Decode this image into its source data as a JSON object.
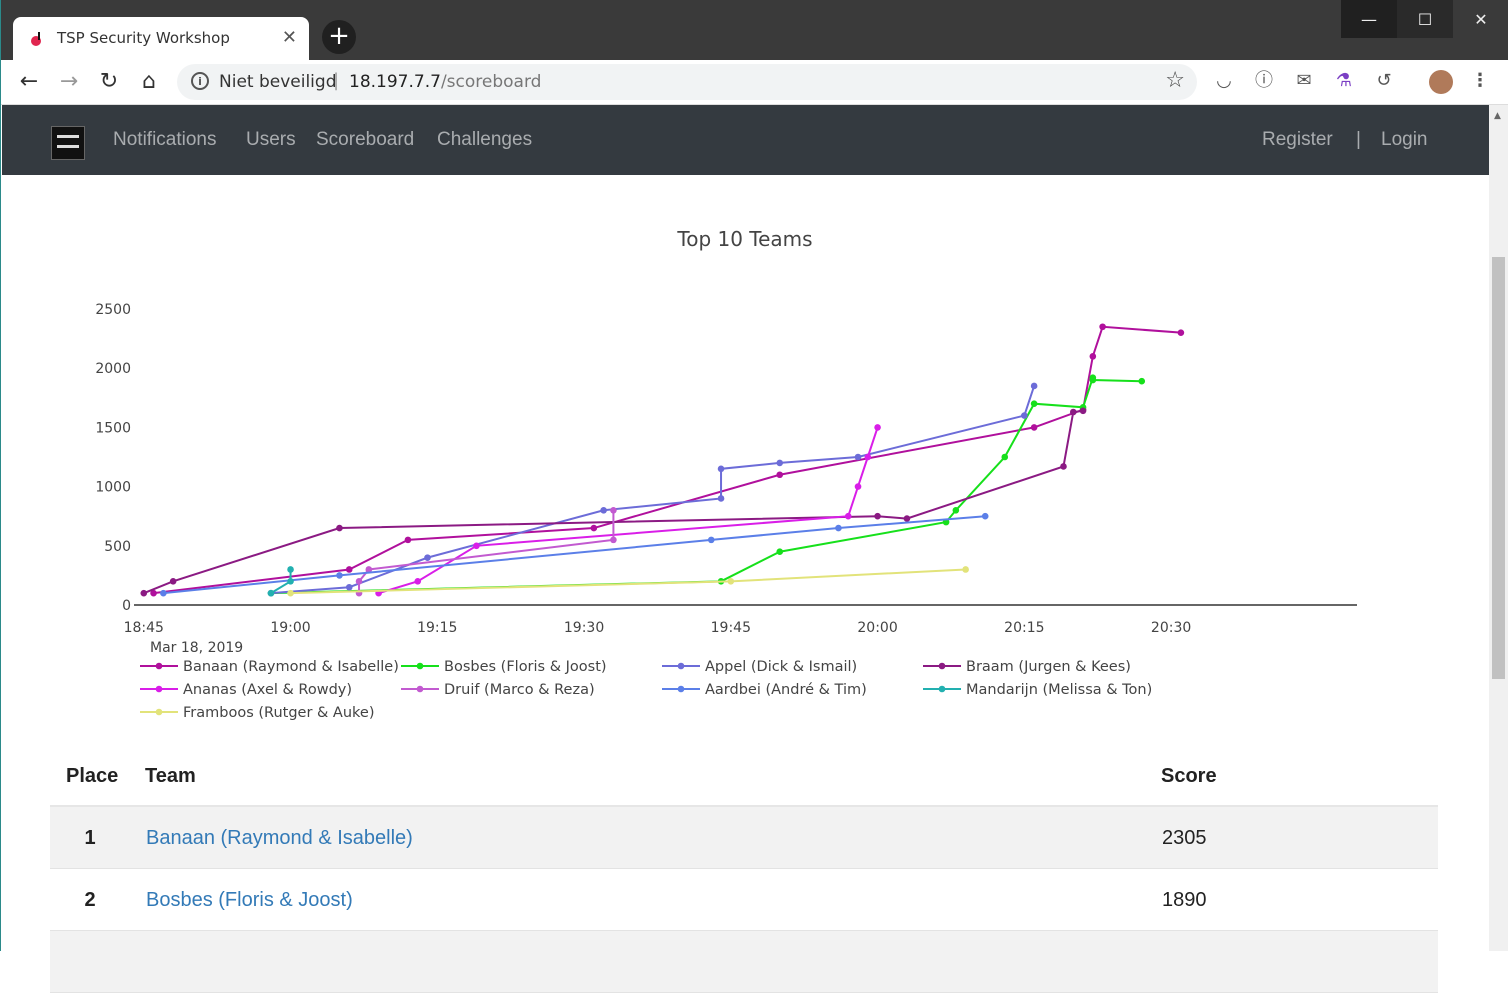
{
  "browser": {
    "tab_title": "TSP Security Workshop",
    "tab_close": "✕",
    "new_tab": "+",
    "window_min": "—",
    "window_max": "☐",
    "window_close": "✕",
    "security_label": "Niet beveiligd",
    "url_host": "18.197.7.7",
    "url_path": "/scoreboard",
    "icons": [
      "back-icon",
      "forward-icon",
      "reload-icon",
      "home-icon",
      "info-icon",
      "star-icon",
      "pocket-icon",
      "privacy-icon",
      "mail-icon",
      "flask-icon",
      "history-icon",
      "avatar",
      "menu-icon"
    ]
  },
  "navbar": {
    "links": [
      "Notifications",
      "Users",
      "Scoreboard",
      "Challenges"
    ],
    "register": "Register",
    "separator": "|",
    "login": "Login"
  },
  "chart_data": {
    "type": "line",
    "title": "Top 10 Teams",
    "xlabel": "",
    "ylabel": "",
    "x_ticks": [
      "18:45",
      "19:00",
      "19:15",
      "19:30",
      "19:45",
      "20:00",
      "20:15",
      "20:30"
    ],
    "x_date_label": "Mar 18, 2019",
    "y_ticks": [
      0,
      500,
      1000,
      1500,
      2000,
      2500
    ],
    "ylim": [
      0,
      2500
    ],
    "xlim": [
      "18:44",
      "20:49"
    ],
    "grid": false,
    "legend_position": "bottom",
    "series": [
      {
        "name": "Banaan (Raymond & Isabelle)",
        "color": "#b0109c",
        "x": [
          "18:46",
          "19:06",
          "19:12",
          "19:31",
          "19:50",
          "20:16",
          "20:21",
          "20:22",
          "20:23",
          "20:31"
        ],
        "y": [
          100,
          300,
          550,
          650,
          1100,
          1500,
          1650,
          2100,
          2350,
          2300
        ]
      },
      {
        "name": "Bosbes (Floris & Joost)",
        "color": "#16e01b",
        "x": [
          "18:58",
          "19:44",
          "19:50",
          "20:07",
          "20:08",
          "20:13",
          "20:16",
          "20:21",
          "20:22",
          "20:22",
          "20:27"
        ],
        "y": [
          100,
          200,
          450,
          700,
          800,
          1250,
          1700,
          1670,
          1920,
          1900,
          1890
        ]
      },
      {
        "name": "Appel (Dick & Ismail)",
        "color": "#6c6cd8",
        "x": [
          "18:58",
          "19:06",
          "19:14",
          "19:32",
          "19:44",
          "19:44",
          "19:50",
          "19:58",
          "20:15",
          "20:16"
        ],
        "y": [
          100,
          150,
          400,
          800,
          900,
          1150,
          1200,
          1250,
          1600,
          1850
        ]
      },
      {
        "name": "Braam (Jurgen & Kees)",
        "color": "#8b1a83",
        "x": [
          "18:45",
          "18:48",
          "19:05",
          "20:00",
          "20:03",
          "20:19",
          "20:20",
          "20:21"
        ],
        "y": [
          100,
          200,
          650,
          750,
          730,
          1170,
          1630,
          1640
        ]
      },
      {
        "name": "Ananas (Axel & Rowdy)",
        "color": "#d91ee8",
        "x": [
          "19:09",
          "19:13",
          "19:19",
          "19:57",
          "19:58",
          "19:59",
          "20:00"
        ],
        "y": [
          100,
          200,
          500,
          750,
          1000,
          1250,
          1500
        ]
      },
      {
        "name": "Druif (Marco & Reza)",
        "color": "#c25ad0",
        "x": [
          "19:07",
          "19:07",
          "19:08",
          "19:33",
          "19:33"
        ],
        "y": [
          100,
          200,
          300,
          550,
          800
        ]
      },
      {
        "name": "Aardbei (André & Tim)",
        "color": "#5b7fe8",
        "x": [
          "18:47",
          "19:05",
          "19:43",
          "19:56",
          "20:11"
        ],
        "y": [
          100,
          250,
          550,
          650,
          750
        ]
      },
      {
        "name": "Mandarijn (Melissa & Ton)",
        "color": "#22b0b0",
        "x": [
          "18:58",
          "19:00",
          "19:00"
        ],
        "y": [
          100,
          200,
          300
        ]
      },
      {
        "name": "Framboos (Rutger & Auke)",
        "color": "#e2e37a",
        "x": [
          "19:00",
          "19:45",
          "20:09"
        ],
        "y": [
          100,
          200,
          300
        ]
      }
    ]
  },
  "scoreboard": {
    "headers": {
      "place": "Place",
      "team": "Team",
      "score": "Score"
    },
    "rows": [
      {
        "place": "1",
        "team": "Banaan (Raymond & Isabelle)",
        "score": "2305"
      },
      {
        "place": "2",
        "team": "Bosbes (Floris & Joost)",
        "score": "1890"
      },
      {
        "place": "",
        "team": "",
        "score": ""
      }
    ]
  }
}
